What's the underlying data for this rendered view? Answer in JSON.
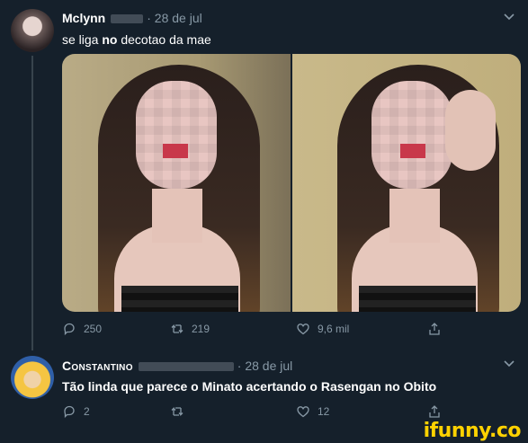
{
  "tweets": [
    {
      "name": "Mclynn",
      "date": "· 28 de jul",
      "text_prefix": "se liga ",
      "text_bold": "no",
      "text_suffix": " decotao da mae",
      "replies": "250",
      "retweets": "219",
      "likes": "9,6 mil"
    },
    {
      "name": "Constantino",
      "date": "· 28 de jul",
      "text": "Tão linda que parece o Minato acertando o Rasengan no Obito",
      "replies": "2",
      "retweets": "",
      "likes": "12"
    }
  ],
  "icons": [
    "chevron-down-icon",
    "reply-icon",
    "retweet-icon",
    "like-icon",
    "share-icon"
  ],
  "colors": {
    "background": "#15202b",
    "muted": "#8899a6",
    "watermark": "#ffd200"
  },
  "watermark": "ifunny.co"
}
